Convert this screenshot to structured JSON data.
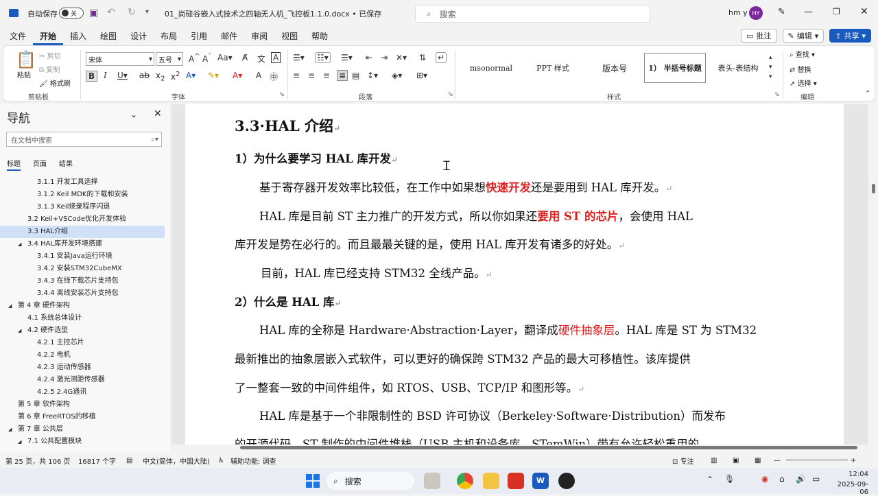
{
  "titlebar": {
    "autosave_label": "自动保存",
    "autosave_state": "关",
    "doc_title": "01_尚硅谷嵌入式技术之四轴无人机_飞控板1.1.0.docx • 已保存",
    "search_placeholder": "搜索",
    "user_name": "hm y",
    "user_initials": "HY"
  },
  "menu": {
    "tabs": [
      "文件",
      "开始",
      "插入",
      "绘图",
      "设计",
      "布局",
      "引用",
      "邮件",
      "审阅",
      "视图",
      "帮助"
    ],
    "comment_btn": "批注",
    "edit_btn": "编辑",
    "share_btn": "共享"
  },
  "ribbon": {
    "paste": "粘贴",
    "cut": "剪切",
    "copy": "复制",
    "format_painter": "格式刷",
    "clipboard_label": "剪贴板",
    "font_name": "宋体",
    "font_size": "五号",
    "font_label": "字体",
    "paragraph_label": "段落",
    "styles": [
      "msonormal",
      "PPT 样式",
      "版本号",
      "1） 半括号标题",
      "表头-表结构"
    ],
    "styles_label": "样式",
    "find": "查找",
    "replace": "替换",
    "select": "选择",
    "edit_label": "编辑"
  },
  "nav": {
    "title": "导航",
    "search_placeholder": "在文档中搜索",
    "tabs": [
      "标题",
      "页面",
      "结果"
    ],
    "items": [
      {
        "text": "3.1.1 开发工具选择",
        "level": 3
      },
      {
        "text": "3.1.2 Keil MDK的下载和安装",
        "level": 3
      },
      {
        "text": "3.1.3 Keil烧录程序闪退",
        "level": 3
      },
      {
        "text": "3.2 Keil+VSCode优化开发体验",
        "level": 2
      },
      {
        "text": "3.3 HAL介绍",
        "level": 2,
        "selected": true
      },
      {
        "text": "3.4 HAL库开发环境搭建",
        "level": 2,
        "expand": true
      },
      {
        "text": "3.4.1 安装Java运行环境",
        "level": 3
      },
      {
        "text": "3.4.2 安装STM32CubeMX",
        "level": 3
      },
      {
        "text": "3.4.3 在线下载芯片支持包",
        "level": 3
      },
      {
        "text": "3.4.4 离线安装芯片支持包",
        "level": 3
      },
      {
        "text": "第 4 章 硬件架构",
        "level": 1,
        "expand": true
      },
      {
        "text": "4.1 系统总体设计",
        "level": 2
      },
      {
        "text": "4.2 硬件选型",
        "level": 2,
        "expand": true
      },
      {
        "text": "4.2.1 主控芯片",
        "level": 3
      },
      {
        "text": "4.2.2 电机",
        "level": 3
      },
      {
        "text": "4.2.3 运动传感器",
        "level": 3
      },
      {
        "text": "4.2.4 激光测距传感器",
        "level": 3
      },
      {
        "text": "4.2.5 2.4G通讯",
        "level": 3
      },
      {
        "text": "第 5 章 软件架构",
        "level": 1
      },
      {
        "text": "第 6 章 FreeRTOS的移植",
        "level": 1
      },
      {
        "text": "第 7 章 公共层",
        "level": 1,
        "expand": true
      },
      {
        "text": "7.1 公共配置模块",
        "level": 2,
        "expand": true
      }
    ]
  },
  "doc": {
    "heading": "3.3·HAL 介绍",
    "sub1": "1）为什么要学习 HAL 库开发",
    "p1a": "基于寄存器开发效率比较低，在工作中如果想",
    "p1red": "快速开发",
    "p1b": "还是要用到 HAL 库开发。",
    "p2a": "HAL 库是目前 ST 主力推广的开发方式，所以你如果还",
    "p2red": "要用 ST 的芯片",
    "p2b": "，会使用 HAL",
    "p2c": "库开发是势在必行的。而且最最关键的是，使用 HAL 库开发有诸多的好处。",
    "p3": "目前，HAL 库已经支持 STM32 全线产品。",
    "sub2": "2）什么是 HAL 库",
    "p4a": "HAL 库的全称是 Hardware·Abstraction·Layer，翻译成",
    "p4red": "硬件抽象层",
    "p4b": "。HAL 库是 ST 为 STM32",
    "p4c": "最新推出的抽象层嵌入式软件，可以更好的确保跨 STM32 产品的最大可移植性。该库提供",
    "p4d": "了一整套一致的中间件组件，如 RTOS、USB、TCP/IP 和图形等。",
    "p5a": "HAL 库是基于一个非限制性的 BSD 许可协议（Berkeley·Software·Distribution）而发布",
    "p5b": "的开源代码。ST 制作的中间件堆栈（USB 主机和设备库，STemWin）带有允许轻松重用的"
  },
  "status": {
    "page": "第 25 页，共 106 页",
    "words": "16817 个字",
    "lang": "中文(简体，中国大陆)",
    "access": "辅助功能: 调查",
    "focus": "专注"
  },
  "taskbar": {
    "search": "搜索",
    "time": "12:04",
    "date": "2025-09-06"
  }
}
